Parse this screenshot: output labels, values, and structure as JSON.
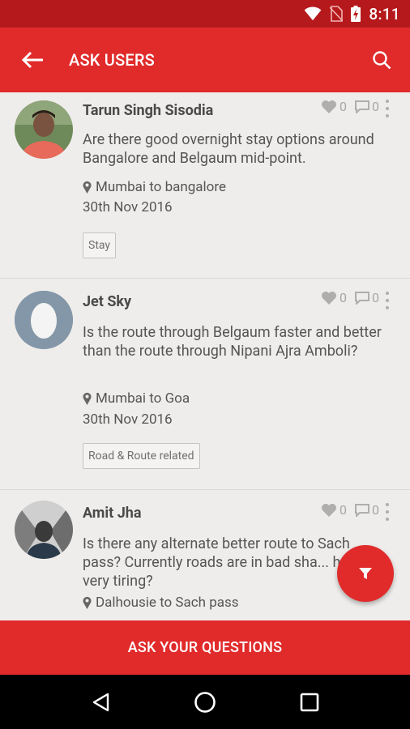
{
  "status_bar": {
    "time": "8:11",
    "icons": [
      "wifi-icon",
      "no-sim-icon",
      "battery-charging-icon"
    ]
  },
  "app_bar": {
    "title": "ASK USERS",
    "back_icon": "arrow-back-icon",
    "search_icon": "search-icon"
  },
  "questions": [
    {
      "user": "Tarun Singh Sisodia",
      "question": "Are there good overnight stay options around Bangalore and Belgaum mid-point.",
      "likes": "0",
      "comments": "0",
      "route": "Mumbai to bangalore",
      "date": "30th Nov 2016",
      "tag": "Stay"
    },
    {
      "user": "Jet Sky",
      "question": "Is the route through Belgaum faster and better than the route through  Nipani Ajra Amboli?",
      "likes": "0",
      "comments": "0",
      "route": "Mumbai to Goa",
      "date": "30th Nov 2016",
      "tag": "Road & Route related"
    },
    {
      "user": "Amit Jha",
      "question": "Is there any alternate better route to Sach pass? Currently roads are in bad sha... hence very tiring?",
      "likes": "0",
      "comments": "0",
      "route": "Dalhousie to Sach pass"
    }
  ],
  "fab": {
    "icon": "filter-icon"
  },
  "bottom_button": {
    "label": "ASK YOUR QUESTIONS"
  },
  "nav_bar": {
    "icons": [
      "back-triangle-icon",
      "home-circle-icon",
      "recents-square-icon"
    ]
  },
  "colors": {
    "accent": "#e12b2b",
    "status_bar": "#b5191c",
    "background": "#efedeb"
  }
}
